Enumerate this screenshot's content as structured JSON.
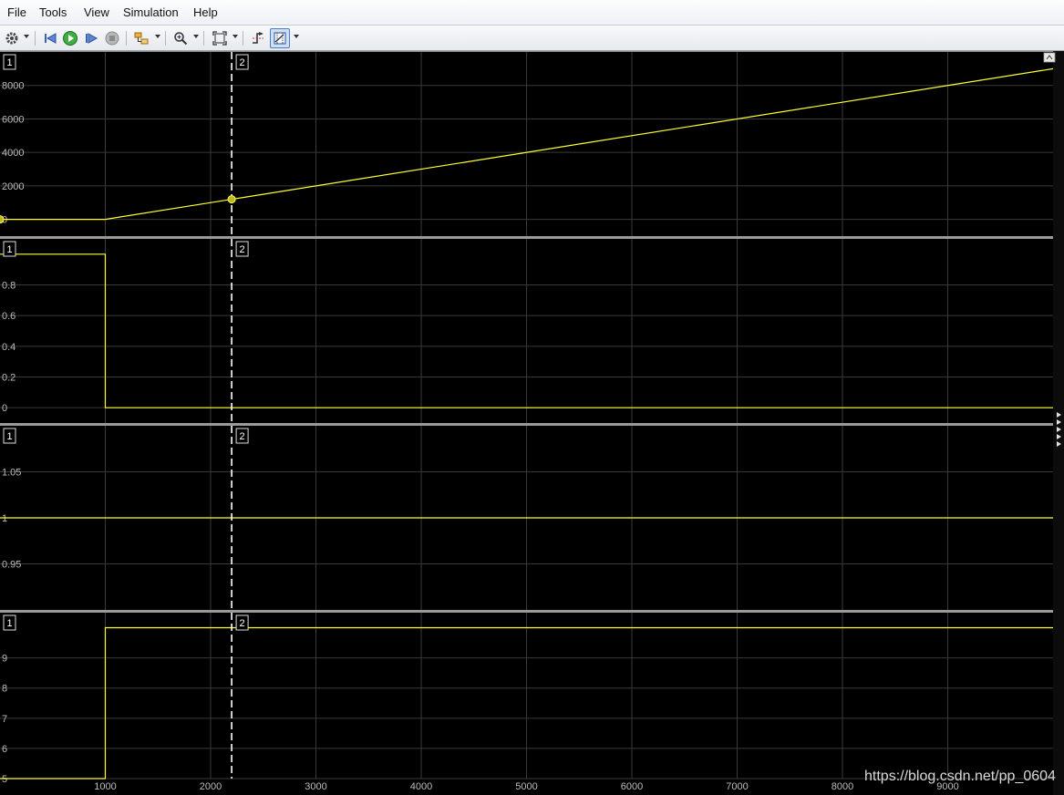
{
  "menu": {
    "items": [
      {
        "key": "file",
        "label": "File"
      },
      {
        "key": "tools",
        "label": "Tools"
      },
      {
        "key": "view",
        "label": "View"
      },
      {
        "key": "simulation",
        "label": "Simulation"
      },
      {
        "key": "help",
        "label": "Help"
      }
    ]
  },
  "toolbar": {
    "icons": [
      "gear-icon",
      "step-back-icon",
      "run-icon",
      "step-forward-icon",
      "stop-icon",
      "highlight-block-icon",
      "zoom-icon",
      "zoom-fit-icon",
      "trigger-icon",
      "cursor-measurement-icon"
    ]
  },
  "colors": {
    "plot_bg": "#000000",
    "signal": "#ffff33",
    "grid": "#3a3a3a",
    "tick_text": "#bdbdbd",
    "cursor": "#ffffff"
  },
  "cursors": {
    "cursor1_label": "1",
    "cursor2_label": "2"
  },
  "watermark": "https://blog.csdn.net/pp_0604",
  "chart_data": [
    {
      "type": "line",
      "xlim": [
        0,
        10000
      ],
      "ylim": [
        -1000,
        10000
      ],
      "ytick_labels": [
        "0",
        "2000",
        "4000",
        "6000",
        "8000"
      ],
      "xtick_labels": [],
      "grid": true,
      "series": [
        {
          "x": [
            0,
            1000,
            10000
          ],
          "y": [
            0,
            0,
            9000
          ]
        }
      ],
      "cursor_x": [
        0,
        2200
      ],
      "marker_points": [
        {
          "x": 0,
          "y": 0
        },
        {
          "x": 2200,
          "y": 1200
        }
      ]
    },
    {
      "type": "line",
      "xlim": [
        0,
        10000
      ],
      "ylim": [
        -0.1,
        1.1
      ],
      "ytick_labels": [
        "0",
        "0.2",
        "0.4",
        "0.6",
        "0.8"
      ],
      "xtick_labels": [],
      "grid": true,
      "series": [
        {
          "x": [
            0,
            1000,
            1000,
            10000
          ],
          "y": [
            1,
            1,
            0,
            0
          ]
        }
      ],
      "cursor_x": [
        0,
        2200
      ]
    },
    {
      "type": "line",
      "xlim": [
        0,
        10000
      ],
      "ylim": [
        0.9,
        1.1
      ],
      "ytick_labels": [
        "0.95",
        "1",
        "1.05"
      ],
      "xtick_labels": [],
      "grid": true,
      "series": [
        {
          "x": [
            0,
            10000
          ],
          "y": [
            1,
            1
          ]
        }
      ],
      "cursor_x": [
        0,
        2200
      ]
    },
    {
      "type": "line",
      "xlim": [
        0,
        10000
      ],
      "ylim": [
        5,
        10.5
      ],
      "ytick_labels": [
        "5",
        "6",
        "7",
        "8",
        "9"
      ],
      "xtick_labels": [
        "1000",
        "2000",
        "3000",
        "4000",
        "5000",
        "6000",
        "7000",
        "8000",
        "9000"
      ],
      "grid": true,
      "series": [
        {
          "x": [
            0,
            1000,
            1000,
            10000
          ],
          "y": [
            5,
            5,
            10,
            10
          ]
        }
      ],
      "cursor_x": [
        0,
        2200
      ]
    }
  ]
}
